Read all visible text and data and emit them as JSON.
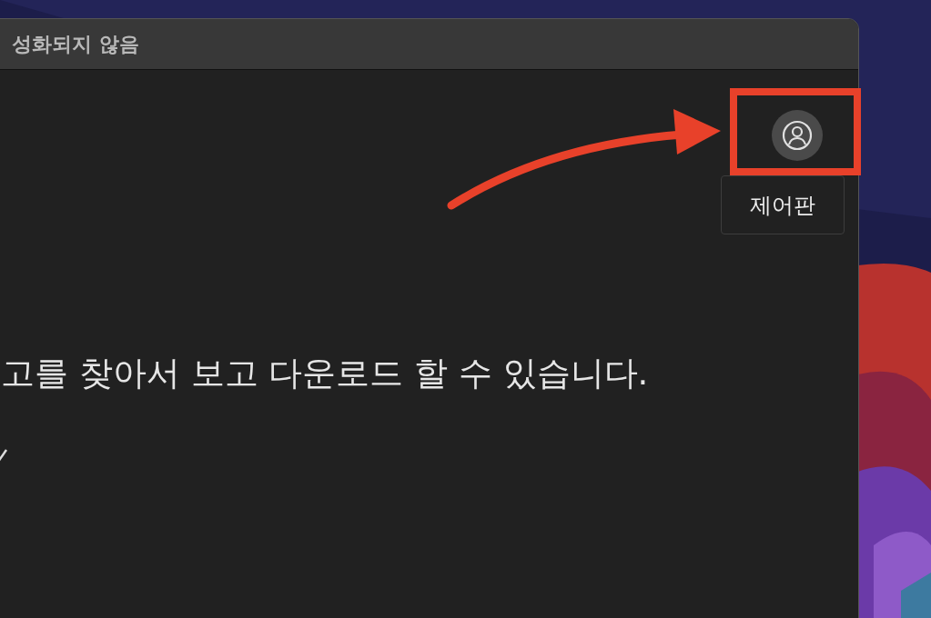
{
  "window": {
    "title": "성화되지 않음"
  },
  "content": {
    "text": "고를 찾아서 보고 다운로드 할 수 있습니다."
  },
  "profile_button": {
    "tooltip": "제어판"
  }
}
